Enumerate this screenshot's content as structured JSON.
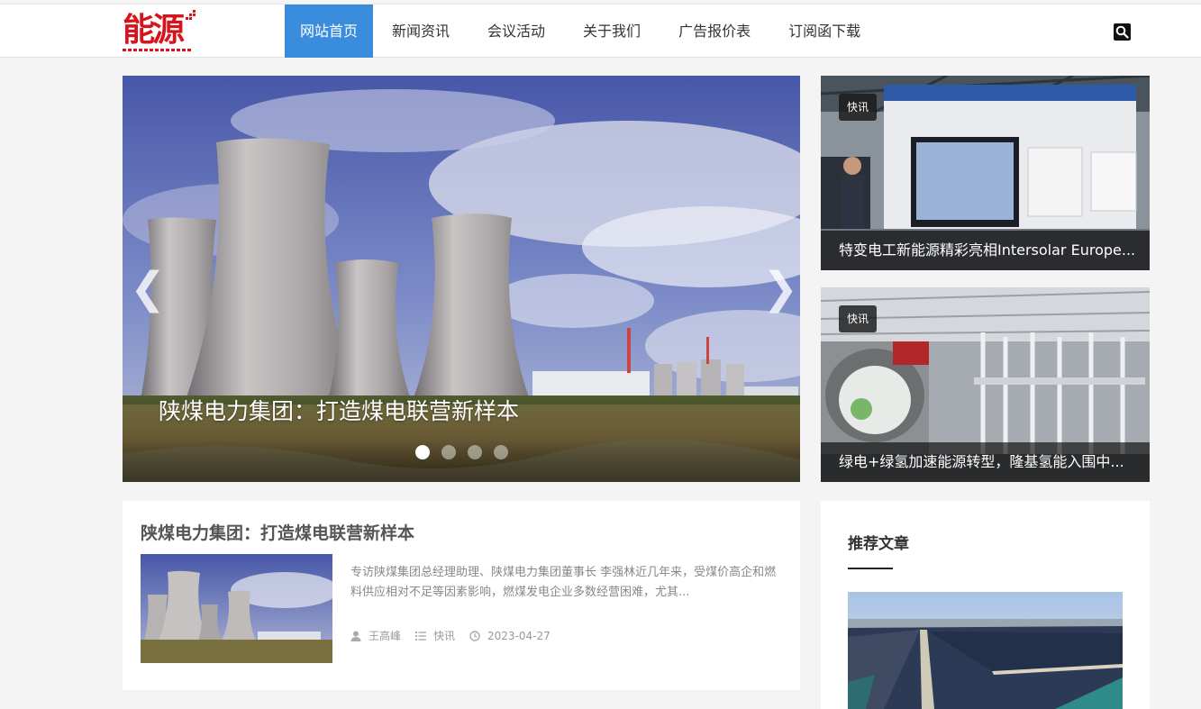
{
  "logo": {
    "text": "能源",
    "tagline": ""
  },
  "nav": {
    "items": [
      {
        "label": "网站首页",
        "active": true
      },
      {
        "label": "新闻资讯",
        "active": false
      },
      {
        "label": "会议活动",
        "active": false
      },
      {
        "label": "关于我们",
        "active": false
      },
      {
        "label": "广告报价表",
        "active": false
      },
      {
        "label": "订阅函下载",
        "active": false
      }
    ],
    "search_icon": "search-icon"
  },
  "slider": {
    "caption": "陕煤电力集团：打造煤电联营新样本",
    "prev_icon": "chevron-left-icon",
    "next_icon": "chevron-right-icon",
    "dot_count": 4,
    "active_dot": 1
  },
  "side_cards": [
    {
      "tag": "快讯",
      "title": "特变电工新能源精彩亮相Intersolar Europe..."
    },
    {
      "tag": "快讯",
      "title": "绿电+绿氢加速能源转型，隆基氢能入围中..."
    }
  ],
  "article": {
    "title": "陕煤电力集团：打造煤电联营新样本",
    "excerpt": "专访陕煤集团总经理助理、陕煤电力集团董事长 李强林近几年来，受煤价高企和燃料供应相对不足等因素影响，燃煤发电企业多数经营困难，尤其...",
    "author": "王高峰",
    "category": "快讯",
    "date": "2023-04-27"
  },
  "recommended": {
    "title": "推荐文章"
  },
  "colors": {
    "accent": "#3a8ddc",
    "brand_red": "#d7141d"
  }
}
